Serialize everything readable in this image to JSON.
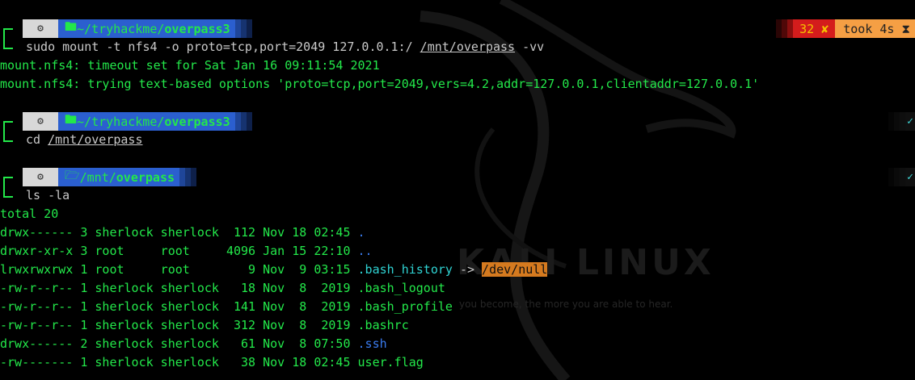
{
  "prompts": [
    {
      "path_prefix": "~/tryhackme/",
      "path_bold": "overpass3",
      "command": "sudo mount -t nfs4 -o proto=tcp,port=2049 127.0.0.1:/ ",
      "command_link": "/mnt/overpass",
      "command_suffix": " -vv",
      "home_icon": "⌂"
    },
    {
      "path_prefix": "~/tryhackme/",
      "path_bold": "overpass3",
      "command": "cd ",
      "command_link": "/mnt/overpass",
      "command_suffix": "",
      "home_icon": "⌂"
    },
    {
      "path_prefix": "/mnt/",
      "path_bold": "overpass",
      "command": "ls -la",
      "command_link": "",
      "command_suffix": "",
      "home_icon": "🗁"
    }
  ],
  "status": {
    "error_code": "32 ✘",
    "took": "took 4s ⧗",
    "check": "✓"
  },
  "output1": [
    "mount.nfs4: timeout set for Sat Jan 16 09:11:54 2021",
    "mount.nfs4: trying text-based options 'proto=tcp,port=2049,vers=4.2,addr=127.0.0.1,clientaddr=127.0.0.1'"
  ],
  "ls_total": "total 20",
  "ls_rows": [
    {
      "meta": "drwx------ 3 sherlock sherlock  112 Nov 18 02:45 ",
      "name": "."
    },
    {
      "meta": "drwxr-xr-x 3 root     root     4096 Jan 15 22:10 ",
      "name": ".."
    },
    {
      "meta": "lrwxrwxrwx 1 root     root        9 Nov  9 03:15 ",
      "name": ".bash_history",
      "arrow": " -> ",
      "target": "/dev/null"
    },
    {
      "meta": "-rw-r--r-- 1 sherlock sherlock   18 Nov  8  2019 ",
      "name": ".bash_logout"
    },
    {
      "meta": "-rw-r--r-- 1 sherlock sherlock  141 Nov  8  2019 ",
      "name": ".bash_profile"
    },
    {
      "meta": "-rw-r--r-- 1 sherlock sherlock  312 Nov  8  2019 ",
      "name": ".bashrc"
    },
    {
      "meta": "drwx------ 2 sherlock sherlock   61 Nov  8 07:50 ",
      "name": ".ssh"
    },
    {
      "meta": "-rw------- 1 sherlock sherlock   38 Nov 18 02:45 ",
      "name": "user.flag"
    }
  ],
  "wallpaper": {
    "title": "KALI LINUX",
    "tagline": "you become, the more you are able to hear."
  }
}
